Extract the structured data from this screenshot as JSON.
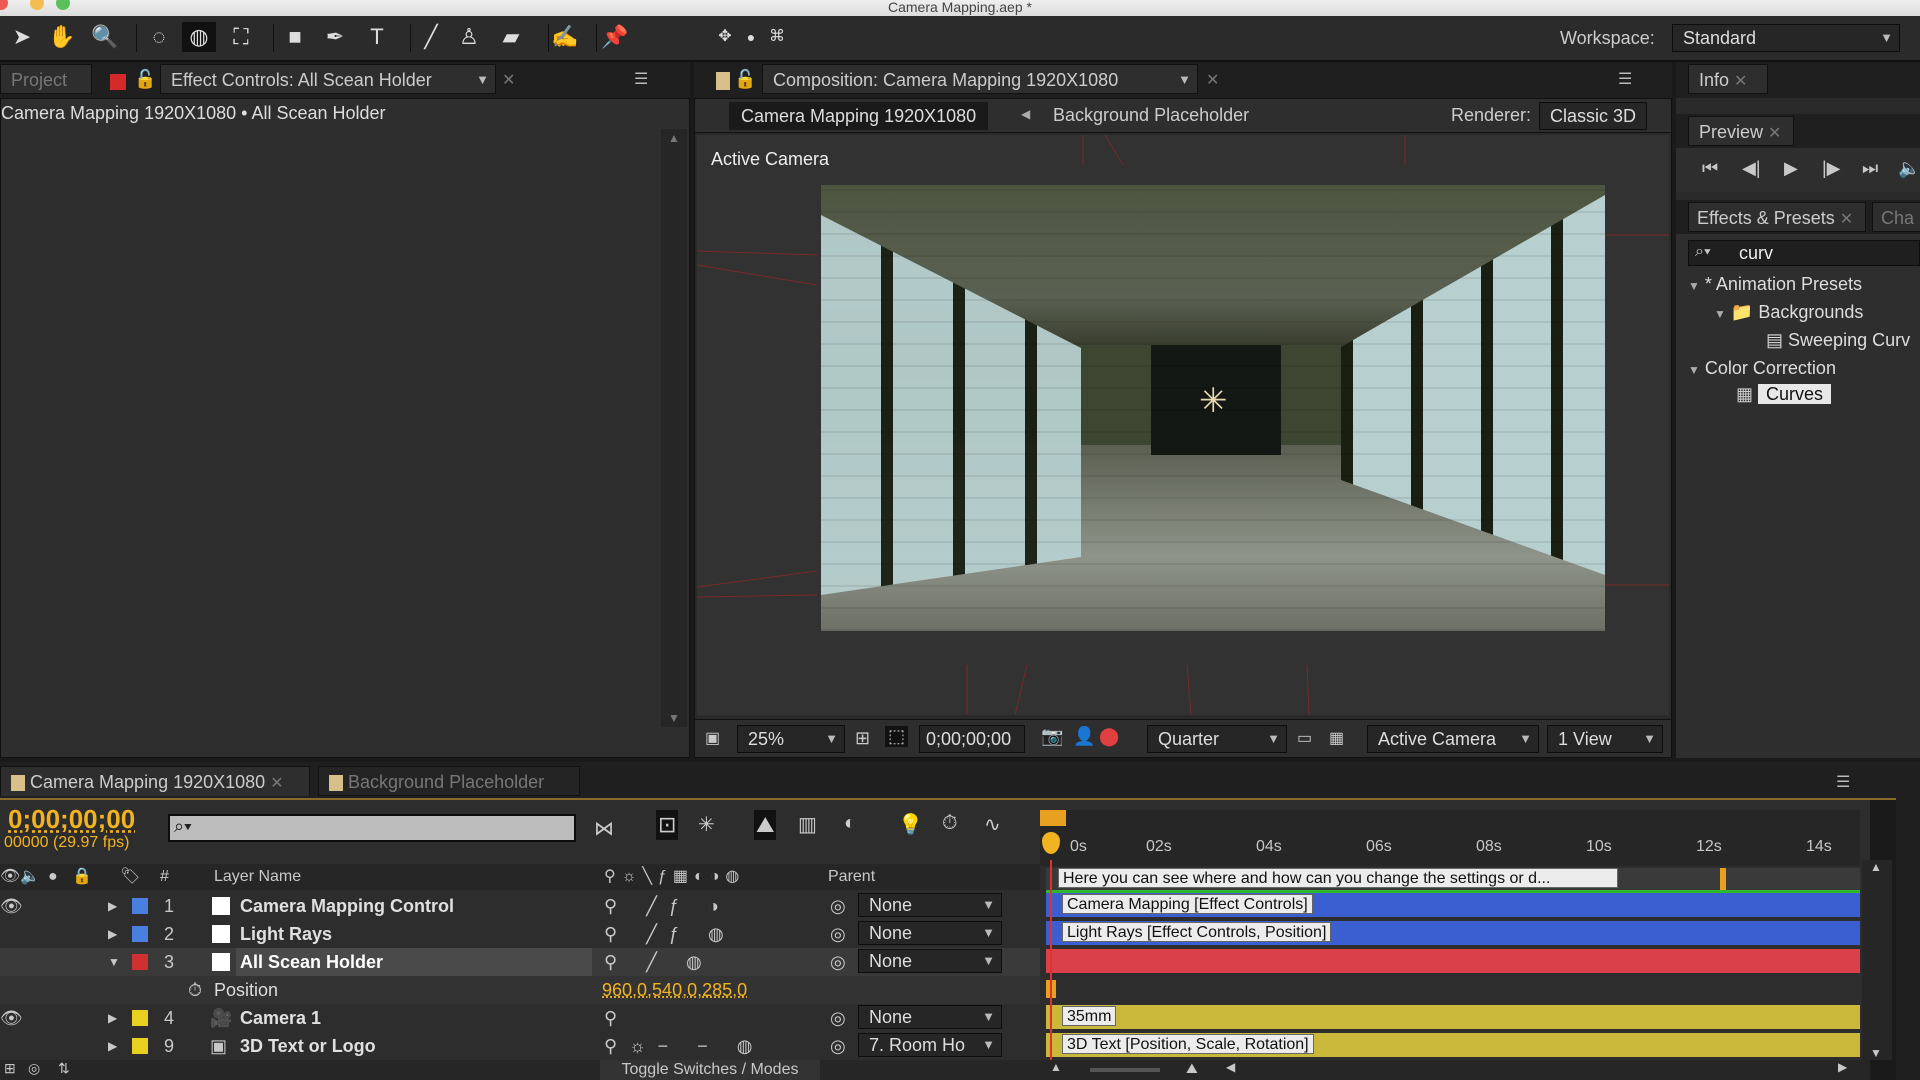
{
  "window": {
    "title": "Camera Mapping.aep *"
  },
  "toolbar": {
    "tools": [
      "selection-tool",
      "hand-tool",
      "zoom-tool",
      "rotate-tool",
      "orbit-camera-tool",
      "track-xy-camera-tool",
      "rectangle-tool",
      "pen-tool",
      "type-tool",
      "brush-tool",
      "clone-stamp-tool",
      "eraser-tool",
      "roto-brush-tool",
      "puppet-pin-tool"
    ],
    "workspace_label": "Workspace:",
    "workspace_value": "Standard"
  },
  "left_panel": {
    "tab_project": "Project",
    "tab_effect_controls": "Effect Controls: All Scean Holder",
    "breadcrumb": "Camera Mapping 1920X1080 • All Scean Holder"
  },
  "comp_panel": {
    "tab": "Composition: Camera Mapping 1920X1080",
    "nav_current": "Camera Mapping 1920X1080",
    "nav_next": "Background Placeholder",
    "renderer_label": "Renderer:",
    "renderer_value": "Classic 3D",
    "view_label": "Active Camera",
    "footer": {
      "zoom": "25%",
      "timecode": "0;00;00;00",
      "resolution": "Quarter",
      "camera": "Active Camera",
      "views": "1 View"
    }
  },
  "right_panel": {
    "info_tab": "Info",
    "preview_tab": "Preview",
    "effects_tab": "Effects & Presets",
    "char_tab": "Cha",
    "search_value": "curv",
    "tree": [
      {
        "label": "* Animation Presets",
        "level": 0,
        "expanded": true
      },
      {
        "label": "Backgrounds",
        "level": 1,
        "expanded": true,
        "folder": true
      },
      {
        "label": "Sweeping Curv",
        "level": 2
      },
      {
        "label": "Color Correction",
        "level": 0,
        "expanded": true
      },
      {
        "label": "Curves",
        "level": 1,
        "selected": true
      }
    ]
  },
  "timeline": {
    "tab_active": "Camera Mapping 1920X1080",
    "tab_other": "Background Placeholder",
    "timecode": "0;00;00;00",
    "frames": "00000 (29.97 fps)",
    "search_placeholder": "",
    "col_hash": "#",
    "col_layer_name": "Layer Name",
    "col_parent": "Parent",
    "ruler": [
      "0s",
      "02s",
      "04s",
      "06s",
      "08s",
      "10s",
      "12s",
      "14s"
    ],
    "comment": "Here you can see where and how can you change the settings or d...",
    "layers": [
      {
        "num": "1",
        "name": "Camera Mapping Control",
        "color": "#4a7fe0",
        "parent": "None",
        "bar_color": "#3b5fd0",
        "bar_label": "Camera Mapping [Effect Controls]"
      },
      {
        "num": "2",
        "name": "Light Rays",
        "color": "#4a7fe0",
        "parent": "None",
        "bar_color": "#3b5fd0",
        "bar_label": "Light Rays [Effect Controls, Position]"
      },
      {
        "num": "3",
        "name": "All Scean Holder",
        "color": "#d03030",
        "parent": "None",
        "bar_color": "#d9404a",
        "bar_label": "",
        "selected": true
      },
      {
        "num": "4",
        "name": "Camera 1",
        "color": "#e8d020",
        "parent": "None",
        "bar_color": "#c9b83a",
        "bar_label": "35mm"
      },
      {
        "num": "9",
        "name": "3D Text or Logo",
        "color": "#e8d020",
        "parent": "7. Room Ho",
        "bar_color": "#c9b83a",
        "bar_label": "3D Text [Position, Scale, Rotation]"
      }
    ],
    "property": {
      "name": "Position",
      "value": "960,0,540,0,285,0"
    },
    "footer_toggle": "Toggle Switches / Modes"
  }
}
